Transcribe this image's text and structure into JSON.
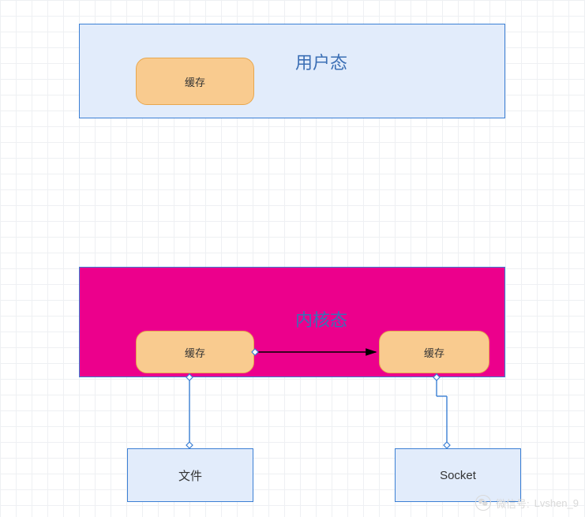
{
  "user_space": {
    "title": "用户态",
    "cache_label": "缓存"
  },
  "kernel_space": {
    "title": "内核态",
    "cache_left_label": "缓存",
    "cache_right_label": "缓存"
  },
  "file_box": {
    "label": "文件"
  },
  "socket_box": {
    "label": "Socket"
  },
  "watermark": {
    "prefix": "微信号:",
    "id": "Lvshen_9"
  }
}
